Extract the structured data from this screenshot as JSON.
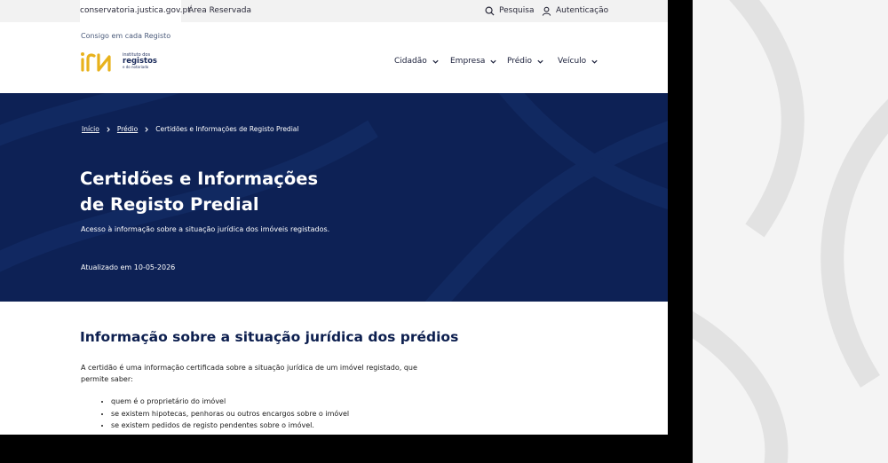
{
  "utility_bar": {
    "domain": "conservatoria.justica.gov.pt",
    "reserved": "Área Reservada",
    "search": "Pesquisa",
    "auth": "Autenticação"
  },
  "header": {
    "tagline": "Consigo em cada Registo",
    "logo": {
      "line1": "instituto dos",
      "line2": "registos",
      "line3": "e do notariado"
    },
    "nav": [
      "Cidadão",
      "Empresa",
      "Prédio",
      "Veículo"
    ]
  },
  "hero": {
    "breadcrumb": [
      "Início",
      "Prédio",
      "Certidões e Informações de Registo Predial"
    ],
    "title": "Certidões e Informações de Registo Predial",
    "subtitle": "Acesso à informação sobre a situação jurídica dos imóveis registados.",
    "updated": "Atualizado em 10-05-2026",
    "background_color": "#0d2155"
  },
  "content": {
    "section_title": "Informação sobre a situação jurídica dos prédios",
    "intro": "A certidão é uma informação certificada sobre a situação jurídica de um imóvel registado, que permite saber:",
    "bullets": [
      "quem é o proprietário do imóvel",
      "se existem hipotecas, penhoras ou outros encargos sobre o imóvel",
      "se existem pedidos de registo pendentes sobre o imóvel."
    ]
  },
  "colors": {
    "brand_gold": "#e8b21c",
    "navy": "#0d2155"
  }
}
